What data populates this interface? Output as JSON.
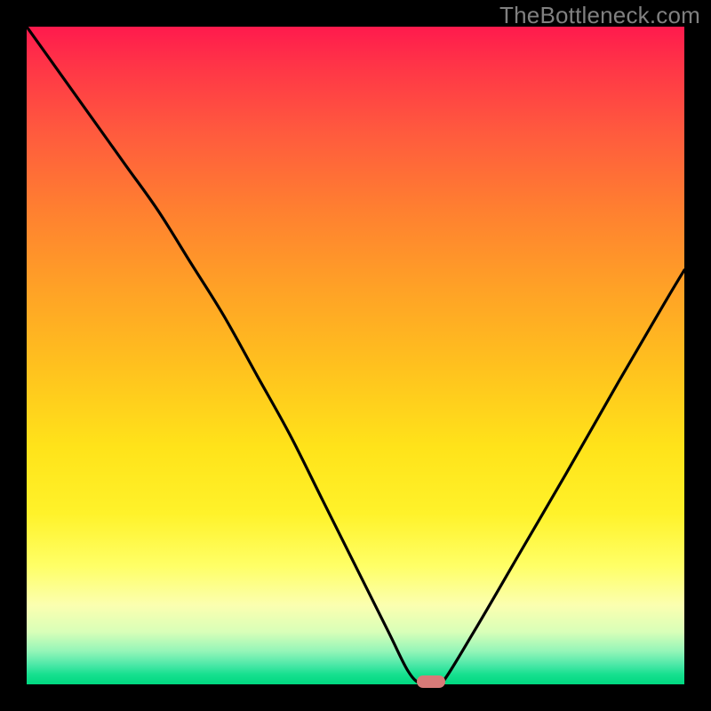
{
  "watermark": "TheBottleneck.com",
  "chart_data": {
    "type": "line",
    "title": "",
    "xlabel": "",
    "ylabel": "",
    "xlim": [
      0,
      100
    ],
    "ylim": [
      0,
      100
    ],
    "grid": false,
    "background_gradient": {
      "top": "#ff1a4d",
      "middle": "#ffe31a",
      "bottom": "#00d880"
    },
    "series": [
      {
        "name": "bottleneck-curve",
        "color": "#000000",
        "x": [
          0,
          5,
          10,
          15,
          20,
          25,
          30,
          35,
          40,
          45,
          50,
          55,
          58,
          60,
          61.5,
          63,
          68,
          75,
          82,
          90,
          97,
          100
        ],
        "y": [
          100,
          93,
          86,
          79,
          72,
          64,
          56,
          47,
          38,
          28,
          18,
          8,
          2,
          0,
          0,
          0,
          8,
          20,
          32,
          46,
          58,
          63
        ]
      }
    ],
    "marker": {
      "name": "optimal-point",
      "x": 61.5,
      "y": 0,
      "color": "#d87a78"
    }
  }
}
